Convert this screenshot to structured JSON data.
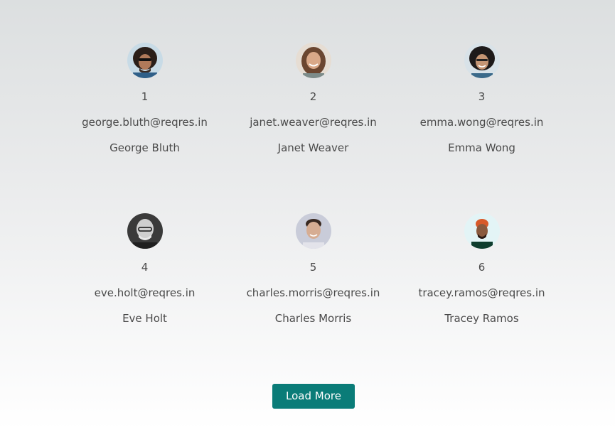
{
  "users": [
    {
      "id": "1",
      "email": "george.bluth@reqres.in",
      "name": "George Bluth",
      "avatar_icon": "user-avatar-george-bluth"
    },
    {
      "id": "2",
      "email": "janet.weaver@reqres.in",
      "name": "Janet Weaver",
      "avatar_icon": "user-avatar-janet-weaver"
    },
    {
      "id": "3",
      "email": "emma.wong@reqres.in",
      "name": "Emma Wong",
      "avatar_icon": "user-avatar-emma-wong"
    },
    {
      "id": "4",
      "email": "eve.holt@reqres.in",
      "name": "Eve Holt",
      "avatar_icon": "user-avatar-eve-holt"
    },
    {
      "id": "5",
      "email": "charles.morris@reqres.in",
      "name": "Charles Morris",
      "avatar_icon": "user-avatar-charles-morris"
    },
    {
      "id": "6",
      "email": "tracey.ramos@reqres.in",
      "name": "Tracey Ramos",
      "avatar_icon": "user-avatar-tracey-ramos"
    }
  ],
  "load_more": {
    "label": "Load More"
  },
  "colors": {
    "button_bg": "#0a7c78",
    "text": "#4a4a4a"
  }
}
